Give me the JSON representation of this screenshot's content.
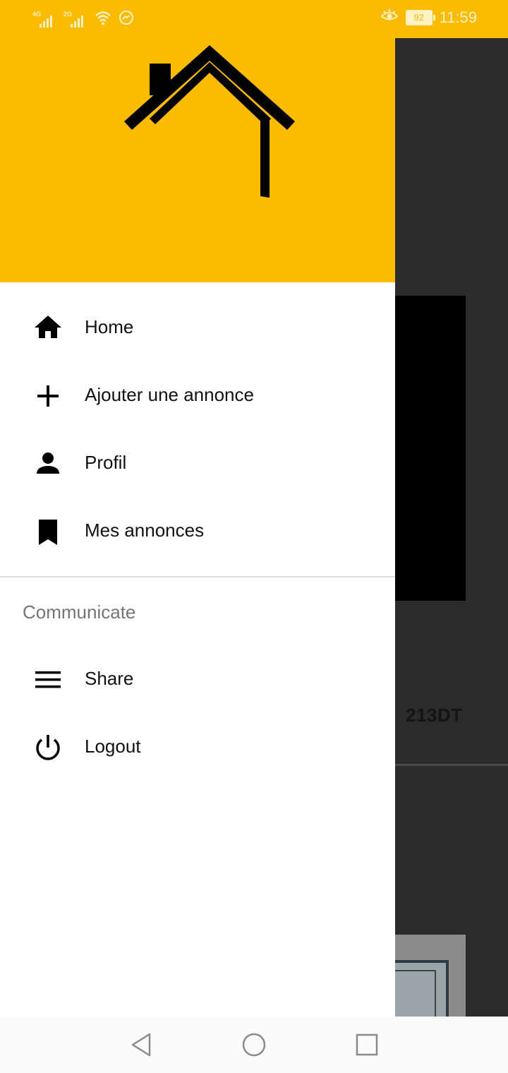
{
  "status_bar": {
    "signal1_tag": "4G",
    "signal2_tag": "2G",
    "battery": "92",
    "time": "11:59"
  },
  "background": {
    "price": "213DT"
  },
  "drawer": {
    "header_logo": "house-logo",
    "items": [
      {
        "label": "Home",
        "icon": "home-icon"
      },
      {
        "label": "Ajouter une annonce",
        "icon": "plus-icon"
      },
      {
        "label": "Profil",
        "icon": "person-icon"
      },
      {
        "label": "Mes annonces",
        "icon": "bookmark-icon"
      }
    ],
    "section_title": "Communicate",
    "section_items": [
      {
        "label": "Share",
        "icon": "menu-icon"
      },
      {
        "label": "Logout",
        "icon": "power-icon"
      }
    ]
  },
  "colors": {
    "accent": "#fcba00",
    "drawer_bg": "#ffffff",
    "text": "#111111",
    "section_text": "#757575"
  },
  "nav_bar": {
    "back": "back-triangle-icon",
    "home": "home-circle-icon",
    "recents": "recents-square-icon"
  }
}
